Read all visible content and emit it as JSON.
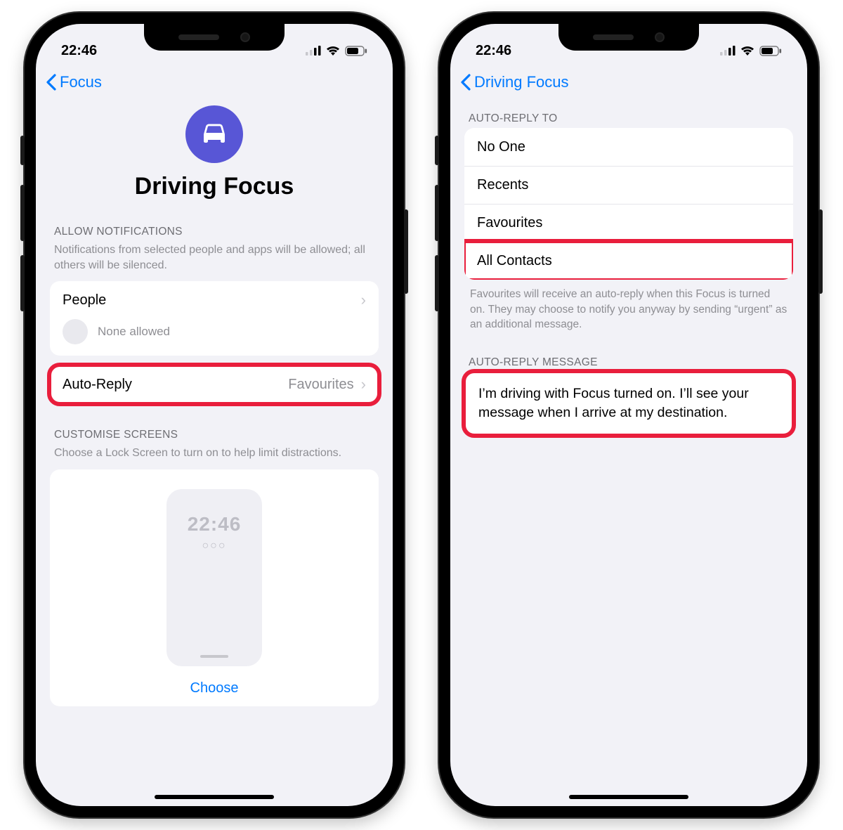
{
  "status": {
    "time": "22:46"
  },
  "left": {
    "back_label": "Focus",
    "title": "Driving Focus",
    "allow_header": "ALLOW NOTIFICATIONS",
    "allow_sub": "Notifications from selected people and apps will be allowed; all others will be silenced.",
    "people_label": "People",
    "people_value": "None allowed",
    "autoreply_label": "Auto-Reply",
    "autoreply_value": "Favourites",
    "screens_header": "CUSTOMISE SCREENS",
    "screens_sub": "Choose a Lock Screen to turn on to help limit distractions.",
    "lock_time": "22:46",
    "choose_label": "Choose"
  },
  "right": {
    "back_label": "Driving Focus",
    "replyto_header": "AUTO-REPLY TO",
    "options": [
      "No One",
      "Recents",
      "Favourites",
      "All Contacts"
    ],
    "footer_note": "Favourites will receive an auto-reply when this Focus is turned on. They may choose to notify you anyway by sending “urgent” as an additional message.",
    "msg_header": "AUTO-REPLY MESSAGE",
    "msg_text": "I’m driving with Focus turned on. I’ll see your message when I arrive at my destination."
  }
}
